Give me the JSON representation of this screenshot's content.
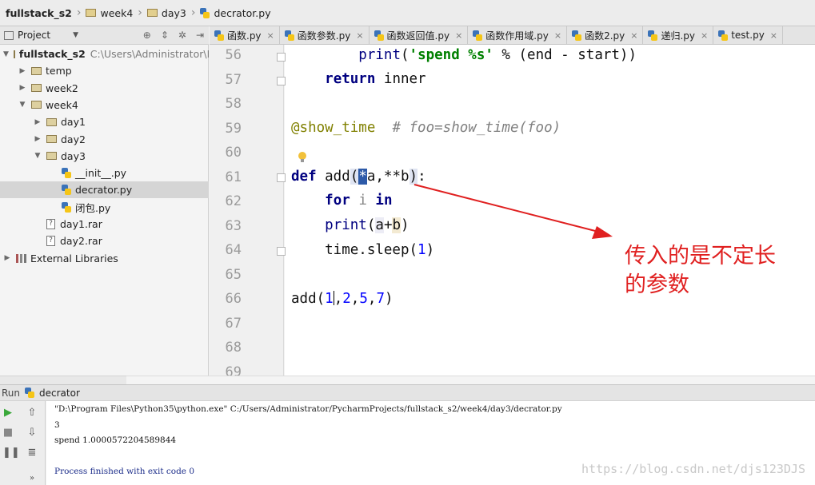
{
  "breadcrumb": [
    "fullstack_s2",
    "week4",
    "day3",
    "decrator.py"
  ],
  "project_panel": {
    "title": "Project",
    "tree": [
      {
        "label": "fullstack_s2",
        "extra": "C:\\Users\\Administrator\\P",
        "kind": "folder",
        "depth": 0,
        "expanded": true,
        "bold": true
      },
      {
        "label": "temp",
        "kind": "folder",
        "depth": 1,
        "expanded": false
      },
      {
        "label": "week2",
        "kind": "folder",
        "depth": 1,
        "expanded": false
      },
      {
        "label": "week4",
        "kind": "folder",
        "depth": 1,
        "expanded": true
      },
      {
        "label": "day1",
        "kind": "folder",
        "depth": 2,
        "expanded": false
      },
      {
        "label": "day2",
        "kind": "folder",
        "depth": 2,
        "expanded": false
      },
      {
        "label": "day3",
        "kind": "folder",
        "depth": 2,
        "expanded": true
      },
      {
        "label": "__init__.py",
        "kind": "py",
        "depth": 3
      },
      {
        "label": "decrator.py",
        "kind": "py",
        "depth": 3,
        "selected": true
      },
      {
        "label": "闭包.py",
        "kind": "py",
        "depth": 3
      },
      {
        "label": "day1.rar",
        "kind": "rar",
        "depth": 2
      },
      {
        "label": "day2.rar",
        "kind": "rar",
        "depth": 2
      },
      {
        "label": "External Libraries",
        "kind": "lib",
        "depth": 0,
        "expanded": false
      }
    ]
  },
  "tabs": [
    "函数.py",
    "函数参数.py",
    "函数返回值.py",
    "函数作用域.py",
    "函数2.py",
    "递归.py",
    "test.py"
  ],
  "editor": {
    "line_numbers": [
      "56",
      "57",
      "58",
      "59",
      "60",
      "61",
      "62",
      "63",
      "64",
      "65",
      "66",
      "67",
      "68",
      "69"
    ]
  },
  "annotation": {
    "line1": "传入的是不定长",
    "line2": "的参数"
  },
  "run": {
    "title": "Run",
    "config": "decrator",
    "output": [
      "\"D:\\Program Files\\Python35\\python.exe\" C:/Users/Administrator/PycharmProjects/fullstack_s2/week4/day3/decrator.py",
      "3",
      "spend 1.0000572204589844",
      "",
      "Process finished with exit code 0"
    ]
  },
  "watermark": "https://blog.csdn.net/djs123DJS",
  "colors": {
    "keyword": "#000080",
    "string": "#008000",
    "number": "#0000ff",
    "decorator": "#808000",
    "annotation": "#e02020",
    "selection": "#2d5aa8"
  }
}
